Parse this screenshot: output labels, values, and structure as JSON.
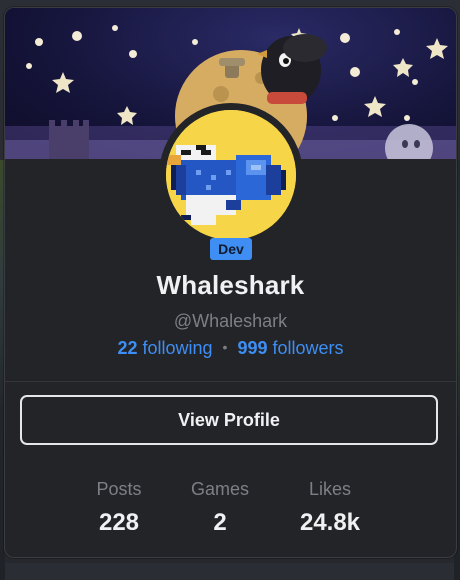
{
  "profile": {
    "badge": "Dev",
    "display_name": "Whaleshark",
    "handle": "@Whaleshark",
    "following_count": "22",
    "following_label": "following",
    "followers_count": "999",
    "followers_label": "followers",
    "separator": "•"
  },
  "actions": {
    "view_profile_label": "View Profile"
  },
  "stats": [
    {
      "label": "Posts",
      "value": "228"
    },
    {
      "label": "Games",
      "value": "2"
    },
    {
      "label": "Likes",
      "value": "24.8k"
    }
  ],
  "colors": {
    "accent": "#3e8ef3",
    "card_bg": "#232428",
    "text_primary": "#f1f1f3",
    "text_muted": "#7d7f86"
  },
  "icons": {
    "banner": "starry-night-banner",
    "avatar": "pixel-whaleshark-avatar"
  }
}
